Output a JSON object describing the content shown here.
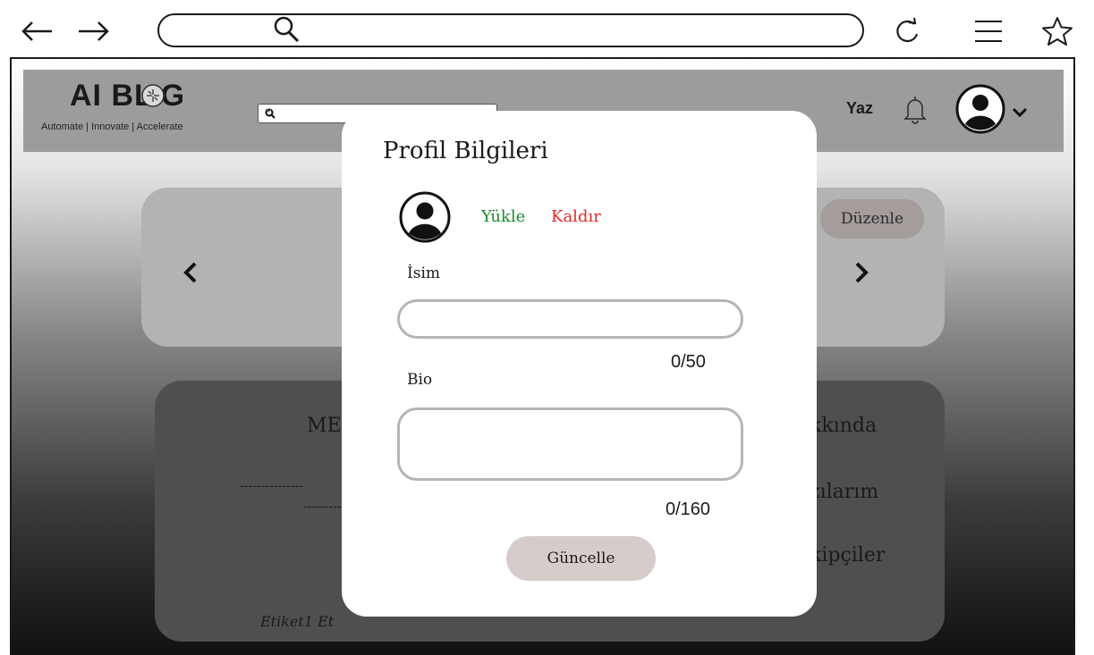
{
  "browser": {
    "back_icon": "arrow-left-icon",
    "forward_icon": "arrow-right-icon",
    "search_icon": "search-icon",
    "reload_icon": "reload-icon",
    "menu_icon": "hamburger-menu-icon",
    "bookmark_icon": "star-icon",
    "url": ""
  },
  "header": {
    "logo_title": "AI BL G",
    "logo_subtitle": "Automate | Innovate | Accelerate",
    "search_placeholder": "",
    "write_label": "Yaz",
    "notification_icon": "bell-icon",
    "profile_icon": "user-avatar-icon",
    "dropdown_icon": "chevron-down-icon"
  },
  "background": {
    "edit_button": "Düzenle",
    "prev_icon": "chevron-left-icon",
    "next_icon": "chevron-right-icon",
    "title_fragment": "ME",
    "dash_line_1": "---------------",
    "dash_line_2": "---------",
    "tags_fragment": "Etiket1  Et",
    "menu_about_fragment": "kkında",
    "menu_posts_fragment": "zılarım",
    "menu_followers_fragment": "kipçiler"
  },
  "modal": {
    "title": "Profil Bilgileri",
    "upload_label": "Yükle",
    "remove_label": "Kaldır",
    "name_label": "İsim",
    "name_value": "",
    "name_counter": "0/50",
    "bio_label": "Bio",
    "bio_value": "",
    "bio_counter": "0/160",
    "update_button": "Güncelle",
    "colors": {
      "upload": "#1f8a2a",
      "remove": "#e52a2a",
      "button_bg": "#d6cdcb"
    }
  }
}
